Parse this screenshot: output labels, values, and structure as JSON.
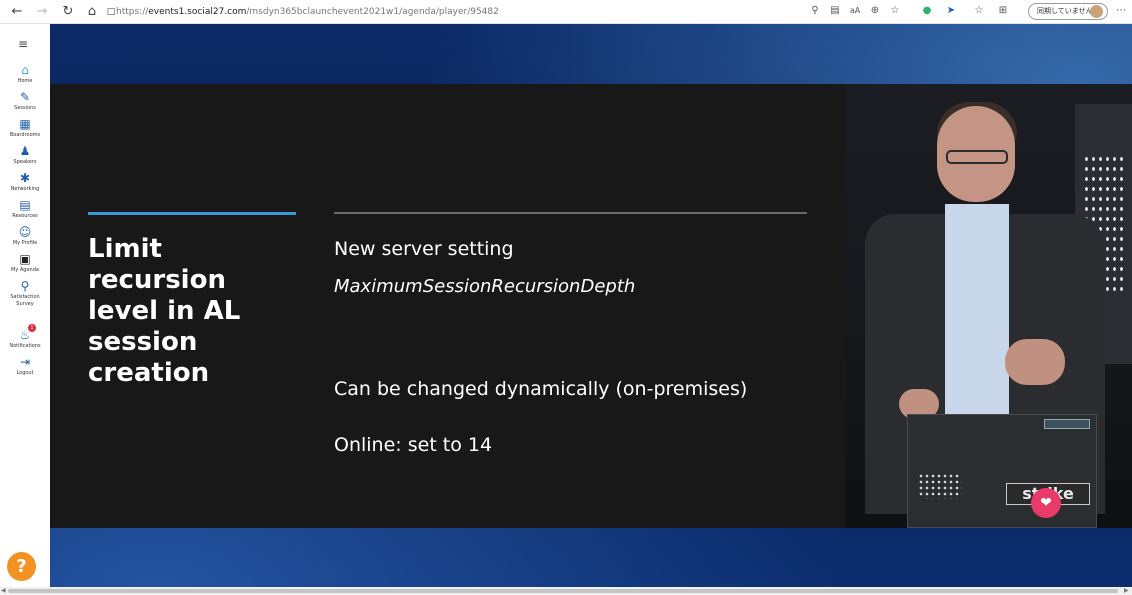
{
  "browser": {
    "url_prefix": "https://",
    "url_host": "events1.social27.com",
    "url_path": "/msdyn365bclaunchevent2021w1/agenda/player/95482",
    "sync_label": "同期していません",
    "icons": [
      "back-icon",
      "forward-icon",
      "refresh-icon",
      "home-icon",
      "lock-icon",
      "search-icon",
      "reader-icon",
      "text-size-icon",
      "zoom-icon",
      "collections-icon",
      "extension-icon",
      "extension-icon",
      "favorites-icon",
      "collections-icon",
      "more-icon"
    ]
  },
  "sidebar": {
    "items": [
      {
        "label": "Home",
        "icon": "home-icon"
      },
      {
        "label": "Sessions",
        "icon": "pencil-icon"
      },
      {
        "label": "Boardrooms",
        "icon": "boardroom-icon"
      },
      {
        "label": "Speakers",
        "icon": "speaker-icon"
      },
      {
        "label": "Networking",
        "icon": "networking-icon"
      },
      {
        "label": "Resources",
        "icon": "resources-icon"
      },
      {
        "label": "My Profile",
        "icon": "profile-icon"
      },
      {
        "label": "My Agenda",
        "icon": "calendar-icon"
      },
      {
        "label": "Satisfaction Survey",
        "icon": "survey-icon"
      },
      {
        "label": "Notifications",
        "icon": "bell-icon"
      },
      {
        "label": "Logout",
        "icon": "logout-icon"
      }
    ],
    "notification_count": "1",
    "help_label": "?"
  },
  "slide": {
    "title": "Limit recursion\nlevel in AL\nsession\ncreation",
    "bullets": [
      "New server setting",
      "MaximumSessionRecursionDepth",
      "Can be changed dynamically (on-premises)",
      "Online: set to 14"
    ]
  },
  "video": {
    "laptop_sticker": "strike"
  },
  "colors": {
    "accent_blue": "#3a9ad9",
    "slide_bg": "#181818",
    "help_orange": "#f39223",
    "like_pink": "#e93b6a",
    "nav_blue": "#1f5ea8"
  }
}
